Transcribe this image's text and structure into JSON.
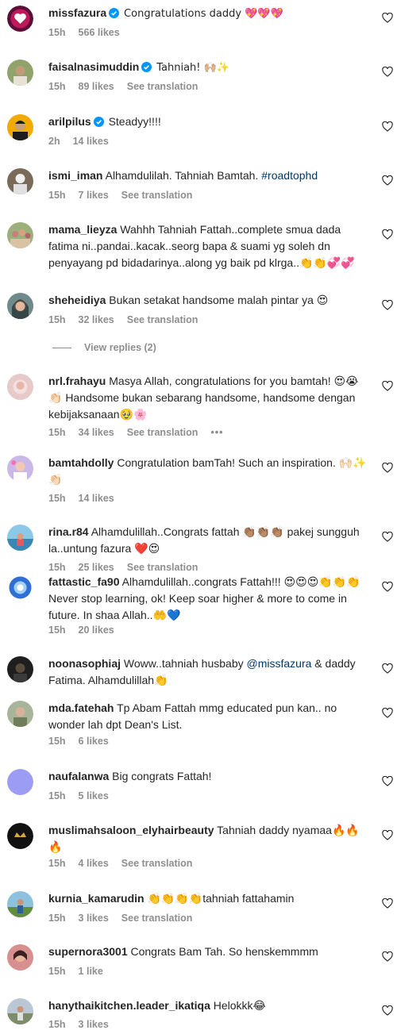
{
  "comments": [
    {
      "user": "missfazura",
      "verified": true,
      "text": "Congratulations daddy 💖💖💖",
      "time": "15h",
      "likes": "566 likes",
      "translation": ""
    },
    {
      "user": "faisalnasimuddin",
      "verified": true,
      "text": "Tahniah! 🙌🏼✨",
      "time": "15h",
      "likes": "89 likes",
      "translation": "See translation"
    },
    {
      "user": "arilpilus",
      "verified": true,
      "text": "Steadyy!!!!",
      "time": "2h",
      "likes": "14 likes",
      "translation": ""
    },
    {
      "user": "ismi_iman",
      "verified": false,
      "text": "Alhamdulilah. Tahniah Bamtah.",
      "hashtag": "#roadtophd",
      "time": "15h",
      "likes": "7 likes",
      "translation": "See translation"
    },
    {
      "user": "mama_lieyza",
      "verified": false,
      "text": "Wahhh Tahniah Fattah..complete smua dada fatima ni..pandai..kacak..seorg bapa & suami yg soleh dn penyayang pd bidadarinya..along yg baik pd klrga..👏👏💞💞",
      "time": "",
      "likes": "",
      "translation": ""
    },
    {
      "user": "sheheidiya",
      "verified": false,
      "text": "Bukan setakat handsome malah pintar ya 😍",
      "time": "15h",
      "likes": "32 likes",
      "translation": "See translation"
    },
    {
      "user": "nrl.frahayu",
      "verified": false,
      "text": "Masya Allah, congratulations for you bamtah! 😍😭👏🏻 Handsome bukan sebarang handsome, handsome dengan kebijaksanaan🥹🌸",
      "time": "15h",
      "likes": "34 likes",
      "translation": "See translation",
      "more": "•••"
    },
    {
      "user": "bamtahdolly",
      "verified": false,
      "text": "Congratulation bamTah! Such an inspiration. 🙌🏻✨👏🏻",
      "time": "15h",
      "likes": "14 likes",
      "translation": ""
    },
    {
      "user": "rina.r84",
      "verified": false,
      "text": "Alhamdulillah..Congrats fattah 👏🏽👏🏽👏🏽 pakej sungguh la..untung fazura ❤️😍",
      "time": "15h",
      "likes": "25 likes",
      "translation": "See translation"
    },
    {
      "user": "fattastic_fa90",
      "verified": false,
      "text": "Alhamdulillah..congrats Fattah!!! 😍😍😍👏👏👏 Never stop learning, ok! Keep soar higher & more to come in future. In shaa Allah..🤲💙",
      "time": "15h",
      "likes": "20 likes",
      "translation": ""
    },
    {
      "user": "noonasophiaj",
      "verified": false,
      "text": "Woww..tahniah husbaby",
      "mention": "@missfazura",
      "text_after": " & daddy Fatima. Alhamdulillah👏",
      "time": "",
      "likes": "",
      "translation": ""
    },
    {
      "user": "mda.fatehah",
      "verified": false,
      "text": "Tp Abam Fattah mmg educated pun kan.. no wonder lah dpt Dean's List.",
      "time": "15h",
      "likes": "6 likes",
      "translation": ""
    },
    {
      "user": "naufalanwa",
      "verified": false,
      "text": "Big congrats Fattah!",
      "time": "15h",
      "likes": "5 likes",
      "translation": ""
    },
    {
      "user": "muslimahsaloon_elyhairbeauty",
      "verified": false,
      "text": "Tahniah daddy nyamaa🔥🔥🔥",
      "time": "15h",
      "likes": "4 likes",
      "translation": "See translation"
    },
    {
      "user": "kurnia_kamarudin",
      "verified": false,
      "text": "👏👏👏👏tahniah fattahamin",
      "time": "15h",
      "likes": "3 likes",
      "translation": "See translation"
    },
    {
      "user": "supernora3001",
      "verified": false,
      "text": "Congrats Bam Tah. So henskemmmm",
      "time": "15h",
      "likes": "1 like",
      "translation": ""
    },
    {
      "user": "hanythaikitchen.leader_ikatiqa",
      "verified": false,
      "text": "Helokkk😂",
      "time": "15h",
      "likes": "3 likes",
      "translation": ""
    }
  ],
  "view_replies": "View replies (2)",
  "colors": {
    "secondary": "#8e8e8e",
    "link": "#00376b",
    "verified": "#0095f6"
  }
}
